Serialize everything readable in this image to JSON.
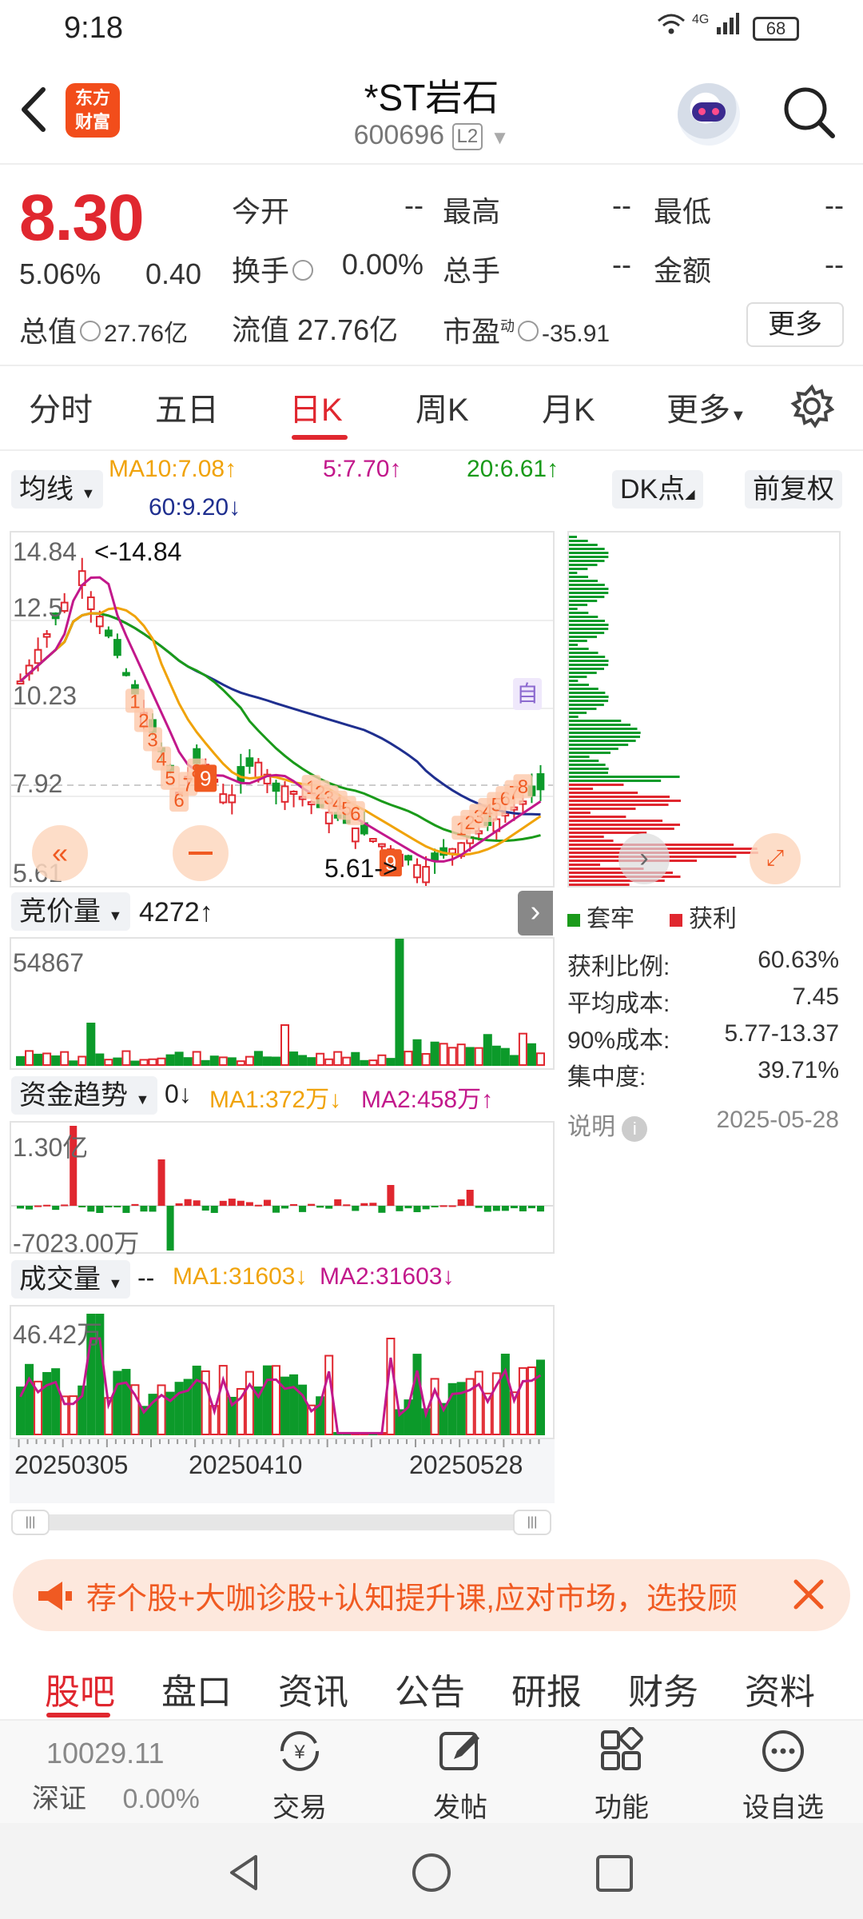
{
  "status_bar": {
    "time": "9:18",
    "network": "4G",
    "battery": "68"
  },
  "header": {
    "logo_line1": "东方",
    "logo_line2": "财富",
    "title": "*ST岩石",
    "code": "600696",
    "level": "L2"
  },
  "quote": {
    "price": "8.30",
    "change_pct": "5.06%",
    "change": "0.40",
    "open_label": "今开",
    "open_value": "--",
    "high_label": "最高",
    "high_value": "--",
    "low_label": "最低",
    "low_value": "--",
    "turnover_label": "换手",
    "turnover_value": "0.00%",
    "volume_label": "总手",
    "volume_value": "--",
    "amount_label": "金额",
    "amount_value": "--",
    "mktcap_label": "总值",
    "mktcap_value": "27.76亿",
    "float_label": "流值",
    "float_value": "27.76亿",
    "pe_label": "市盈",
    "pe_sup": "动",
    "pe_value": "-35.91",
    "more_button": "更多"
  },
  "period_tabs": [
    "分时",
    "五日",
    "日K",
    "周K",
    "月K",
    "更多"
  ],
  "active_period": "日K",
  "ma_bar": {
    "selector": "均线",
    "ma10": "MA10:7.08↑",
    "ma5": "5:7.70↑",
    "ma20": "20:6.61↑",
    "ma60": "60:9.20↓",
    "dk_button": "DK点",
    "adjust_button": "前复权"
  },
  "kline": {
    "y_ticks": [
      "14.84",
      "12.5",
      "10.23",
      "7.92",
      "5.61"
    ],
    "high_annotation": "<-14.84",
    "low_annotation": "5.61->",
    "self_select_tag": "自",
    "marker_9": "9"
  },
  "chip_distribution": {
    "legend_trapped": "套牢",
    "legend_profit": "获利",
    "rows": [
      {
        "label": "获利比例:",
        "value": "60.63%"
      },
      {
        "label": "平均成本:",
        "value": "7.45"
      },
      {
        "label": "90%成本:",
        "value": "5.77-13.37"
      },
      {
        "label": "集中度:",
        "value": "39.71%"
      }
    ],
    "note_label": "说明",
    "date": "2025-05-28"
  },
  "auction": {
    "selector": "竞价量",
    "value": "4272↑",
    "max": "54867"
  },
  "fund_trend": {
    "selector": "资金趋势",
    "value": "0↓",
    "ma1": "MA1:372万↓",
    "ma2": "MA2:458万↑",
    "top": "1.30亿",
    "bottom": "-7023.00万"
  },
  "volume": {
    "selector": "成交量",
    "value": "--",
    "ma1": "MA1:31603↓",
    "ma2": "MA2:31603↓",
    "max": "46.42万"
  },
  "x_dates": [
    "20250305",
    "20250410",
    "20250528"
  ],
  "banner": {
    "text": "荐个股+大咖诊股+认知提升课,应对市场，选投顾"
  },
  "bottom_tabs": [
    "股吧",
    "盘口",
    "资讯",
    "公告",
    "研报",
    "财务",
    "资料"
  ],
  "bottom_bar": {
    "index_value": "10029.11",
    "index_name": "深证",
    "index_change": "0.00%",
    "trade": "交易",
    "post": "发帖",
    "functions": "功能",
    "watchlist": "设自选"
  },
  "colors": {
    "up": "#e0272f",
    "down": "#0c9a2a",
    "ma5": "#c2188b",
    "ma10": "#f0a30a",
    "ma20": "#1a9a1a",
    "ma60": "#1f2f8f",
    "accent": "#f05a22"
  }
}
